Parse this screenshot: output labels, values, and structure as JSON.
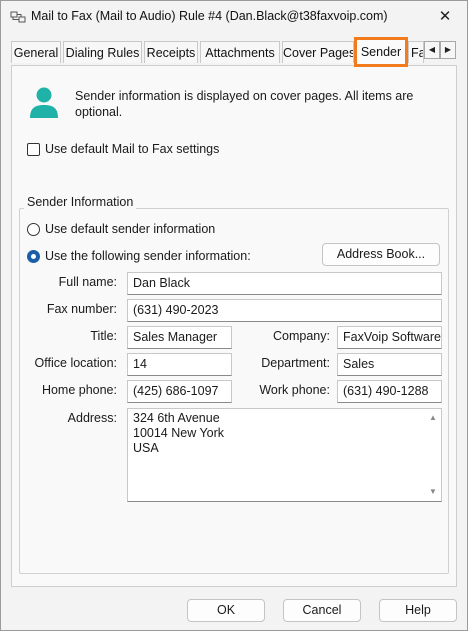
{
  "window": {
    "title": "Mail to Fax (Mail to Audio) Rule #4 (Dan.Black@t38faxvoip.com)",
    "close_glyph": "✕"
  },
  "tabs": [
    {
      "label": "General"
    },
    {
      "label": "Dialing Rules"
    },
    {
      "label": "Receipts"
    },
    {
      "label": "Attachments"
    },
    {
      "label": "Cover Pages"
    },
    {
      "label": "Sender"
    },
    {
      "label": "Fa"
    }
  ],
  "active_tab": "Sender",
  "tab_scroll": {
    "left": "◀",
    "right": "▶"
  },
  "info": {
    "icon": "person-icon",
    "text": "Sender information is displayed on cover pages. All items are optional.",
    "icon_color": "#20b2a8"
  },
  "use_default_settings": {
    "label": "Use default Mail to Fax settings",
    "checked": false
  },
  "sender_group": {
    "title": "Sender Information",
    "radio_default": {
      "label": "Use default sender information",
      "selected": false
    },
    "radio_custom": {
      "label": "Use the following sender information:",
      "selected": true
    },
    "address_book_button": "Address Book...",
    "fields": {
      "full_name": {
        "label": "Full name:",
        "value": "Dan Black"
      },
      "fax_number": {
        "label": "Fax number:",
        "value": "(631) 490-2023"
      },
      "title": {
        "label": "Title:",
        "value": "Sales Manager"
      },
      "company": {
        "label": "Company:",
        "value": "FaxVoip Software, L"
      },
      "office_location": {
        "label": "Office location:",
        "value": "14"
      },
      "department": {
        "label": "Department:",
        "value": "Sales"
      },
      "home_phone": {
        "label": "Home phone:",
        "value": "(425) 686-1097"
      },
      "work_phone": {
        "label": "Work phone:",
        "value": "(631) 490-1288"
      },
      "address": {
        "label": "Address:",
        "lines": [
          "324 6th Avenue",
          "10014 New York",
          "USA"
        ]
      }
    }
  },
  "footer": {
    "ok": "OK",
    "cancel": "Cancel",
    "help": "Help"
  },
  "colors": {
    "accent": "#1c5ea8",
    "highlight": "#f07c1f"
  }
}
